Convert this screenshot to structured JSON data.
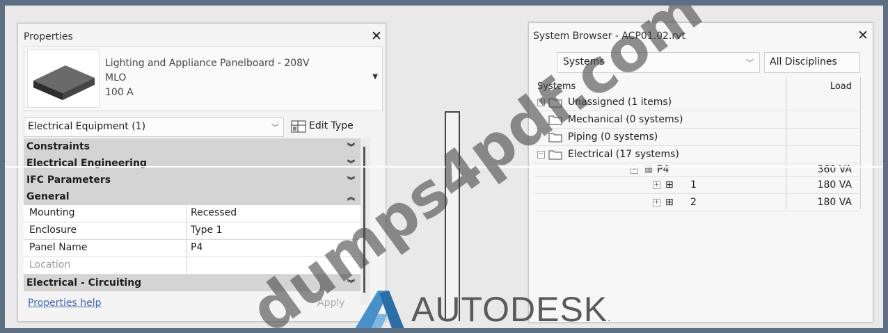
{
  "properties": {
    "title": "Properties",
    "type_lines": [
      "Lighting and Appliance Panelboard - 208V",
      "MLO",
      "100 A"
    ],
    "filter": "Electrical Equipment (1)",
    "edit_type": "Edit Type",
    "groups_top": [
      {
        "label": "Constraints",
        "icon": "double-chevron-down-icon"
      },
      {
        "label": "Electrical Engineering",
        "icon": "double-chevron-down-icon"
      },
      {
        "label": "IFC Parameters",
        "icon": "double-chevron-down-icon"
      },
      {
        "label": "General",
        "icon": "double-chevron-up-icon"
      }
    ],
    "general_rows": [
      {
        "key": "Mounting",
        "value": "Recessed"
      },
      {
        "key": "Enclosure",
        "value": "Type 1"
      },
      {
        "key": "Panel Name",
        "value": "P4"
      },
      {
        "key": "Location",
        "value": ""
      }
    ],
    "group_bottom": {
      "label": "Electrical - Circuiting",
      "icon": "double-chevron-down-icon"
    },
    "help": "Properties help",
    "apply": "Apply"
  },
  "system_browser": {
    "title": "System Browser - ACP01.02.rvt",
    "view_select": "Systems",
    "disciplines": "All Disciplines",
    "col_systems": "Systems",
    "col_load": "Load",
    "rows": [
      {
        "label": "Unassigned (1 items)",
        "load": ""
      },
      {
        "label": "Mechanical (0 systems)",
        "load": ""
      },
      {
        "label": "Piping (0 systems)",
        "load": ""
      },
      {
        "label": "Electrical (17 systems)",
        "load": ""
      },
      {
        "label": "P4",
        "load": "360 VA"
      },
      {
        "label": "1",
        "load": "180 VA"
      },
      {
        "label": "2",
        "load": "180 VA"
      }
    ]
  },
  "logo": {
    "text": "AUTODESK",
    "mark": "."
  },
  "watermark": "dumps4pdf.com"
}
